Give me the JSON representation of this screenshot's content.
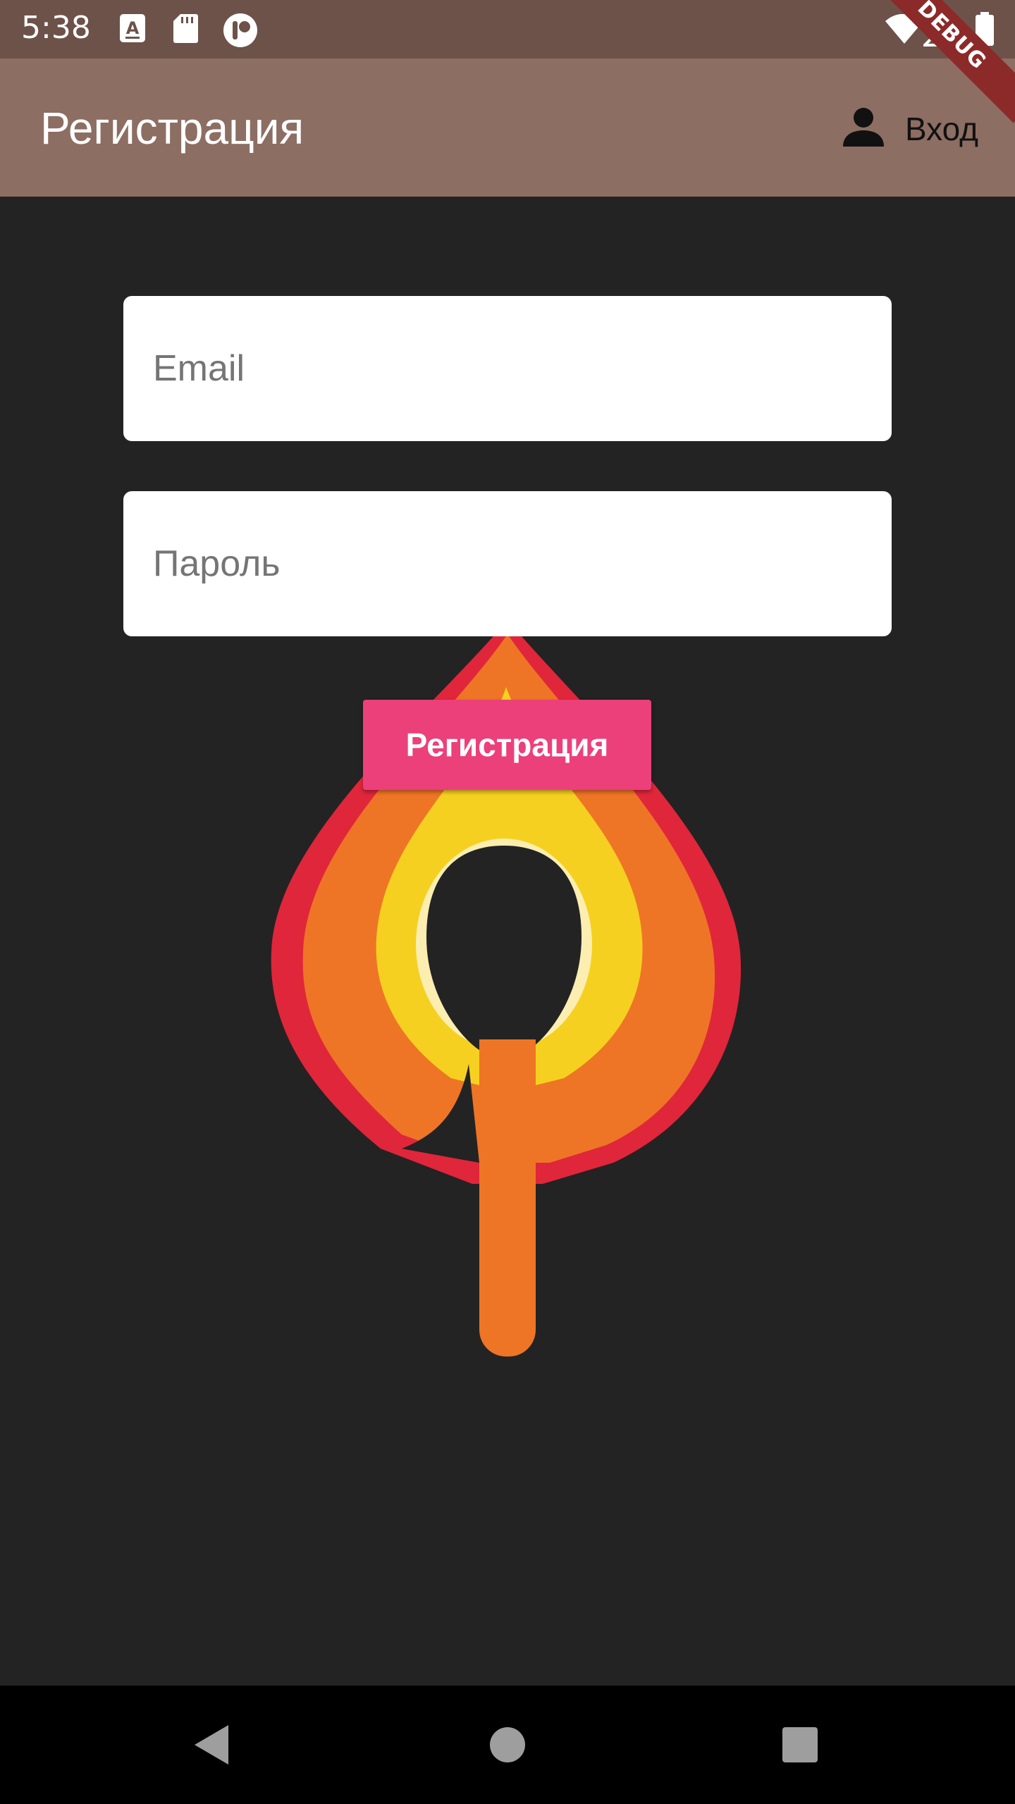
{
  "status_bar": {
    "time": "5:38",
    "left_icons": [
      "text-a-icon",
      "sd-card-icon",
      "app-badge-icon"
    ],
    "right_icons": [
      "wifi-icon",
      "cellular-signal-icon",
      "battery-icon"
    ]
  },
  "debug_banner": "DEBUG",
  "app_bar": {
    "title": "Регистрация",
    "action_icon": "person-icon",
    "action_label": "Вход"
  },
  "form": {
    "email": {
      "placeholder": "Email",
      "value": ""
    },
    "password": {
      "placeholder": "Пароль",
      "value": ""
    },
    "submit_label": "Регистрация"
  },
  "colors": {
    "status_bar": "#6d5249",
    "app_bar": "#8d6e63",
    "background": "#232323",
    "accent": "#ec407a",
    "flame_outer": "#e0263a",
    "flame_mid": "#ee7526",
    "flame_inner": "#f6d020",
    "flame_glow": "#fbeeb0"
  },
  "nav_bar": {
    "buttons": [
      "back-icon",
      "home-icon",
      "recents-icon"
    ]
  }
}
